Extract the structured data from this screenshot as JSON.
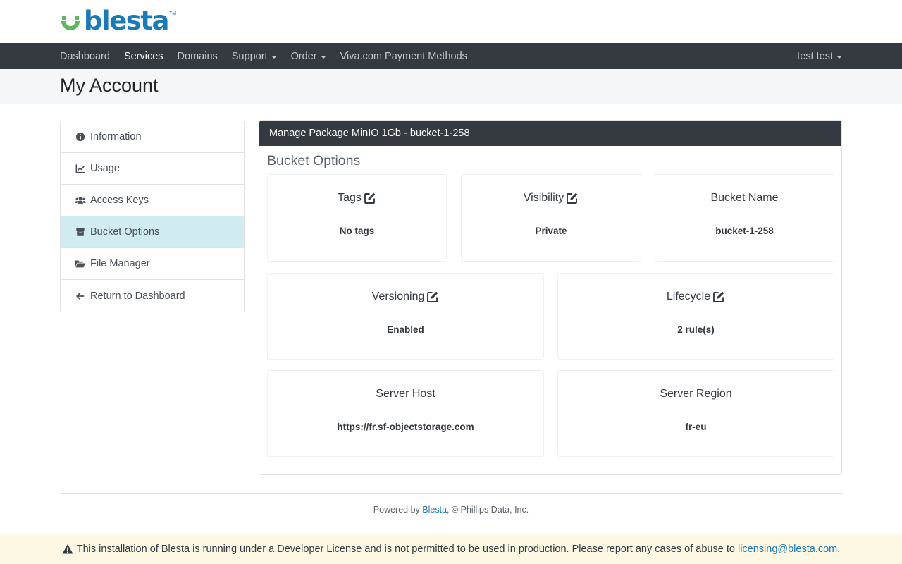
{
  "brand": {
    "name": "blesta",
    "tm": "TM"
  },
  "nav": {
    "items": [
      {
        "label": "Dashboard",
        "dropdown": false,
        "active": false
      },
      {
        "label": "Services",
        "dropdown": false,
        "active": true
      },
      {
        "label": "Domains",
        "dropdown": false,
        "active": false
      },
      {
        "label": "Support",
        "dropdown": true,
        "active": false
      },
      {
        "label": "Order",
        "dropdown": true,
        "active": false
      },
      {
        "label": "Viva.com Payment Methods",
        "dropdown": false,
        "active": false
      }
    ],
    "user": "test test"
  },
  "page": {
    "title": "My Account"
  },
  "sidebar": {
    "items": [
      {
        "label": "Information",
        "icon": "info-circle-icon",
        "active": false
      },
      {
        "label": "Usage",
        "icon": "chart-line-icon",
        "active": false
      },
      {
        "label": "Access Keys",
        "icon": "users-icon",
        "active": false
      },
      {
        "label": "Bucket Options",
        "icon": "box-icon",
        "active": true
      },
      {
        "label": "File Manager",
        "icon": "folder-open-icon",
        "active": false
      },
      {
        "label": "Return to Dashboard",
        "icon": "arrow-left-icon",
        "active": false
      }
    ]
  },
  "panel": {
    "header": "Manage Package MinIO 1Gb - bucket-1-258",
    "subtitle": "Bucket Options",
    "cards": [
      {
        "title": "Tags",
        "value": "No tags",
        "editable": true
      },
      {
        "title": "Visibility",
        "value": "Private",
        "editable": true
      },
      {
        "title": "Bucket Name",
        "value": "bucket-1-258",
        "editable": false
      },
      {
        "title": "Versioning",
        "value": "Enabled",
        "editable": true
      },
      {
        "title": "Lifecycle",
        "value": "2 rule(s)",
        "editable": true
      },
      {
        "title": "Server Host",
        "value": "https://fr.sf-objectstorage.com",
        "editable": false
      },
      {
        "title": "Server Region",
        "value": "fr-eu",
        "editable": false
      }
    ]
  },
  "footer": {
    "prefix": "Powered by ",
    "link": "Blesta",
    "suffix": ", © Phillips Data, Inc."
  },
  "dev_notice": {
    "text": "This installation of Blesta is running under a Developer License and is not permitted to be used in production. Please report any cases of abuse to ",
    "email": "licensing@blesta.com",
    "end": "."
  },
  "colors": {
    "brand_blue": "#1a7ab7",
    "brand_green": "#5cb85c",
    "navbar": "#343a40",
    "active_side": "#d1ecf1",
    "notice_bg": "#fcf8e3"
  }
}
